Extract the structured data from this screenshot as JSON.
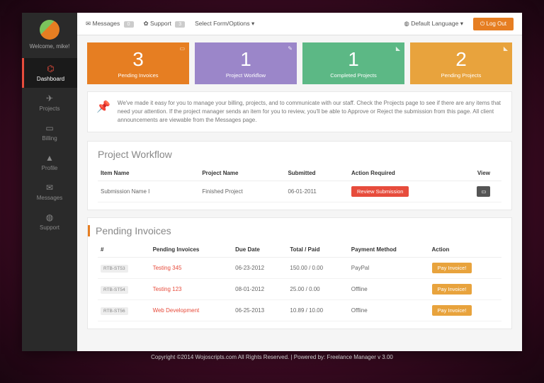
{
  "user": {
    "welcome": "Welcome, mike!"
  },
  "topbar": {
    "messages_label": "Messages",
    "messages_count": "0",
    "support_label": "Support",
    "support_count": "3",
    "form_label": "Select Form/Options",
    "lang_label": "Default Language",
    "logout_label": "Log Out"
  },
  "nav": {
    "dashboard": "Dashboard",
    "projects": "Projects",
    "billing": "Billing",
    "profile": "Profile",
    "messages": "Messages",
    "support": "Support"
  },
  "cards": {
    "c0": {
      "num": "3",
      "label": "Pending Invoices",
      "color": "#e67e22"
    },
    "c1": {
      "num": "1",
      "label": "Project Workflow",
      "color": "#9b86c9"
    },
    "c2": {
      "num": "1",
      "label": "Completed Projects",
      "color": "#5cb885"
    },
    "c3": {
      "num": "2",
      "label": "Pending Projects",
      "color": "#e8a33d"
    }
  },
  "info": "We've made it easy for you to manage your billing, projects, and to communicate with our staff. Check the Projects page to see if there are any items that need your attention. If the project manager sends an item for you to review, you'll be able to Approve or Reject the submission from this page. All client announcements are viewable from the Messages page.",
  "workflow": {
    "title": "Project Workflow",
    "h0": "Item Name",
    "h1": "Project Name",
    "h2": "Submitted",
    "h3": "Action Required",
    "h4": "View",
    "r0": {
      "item": "Submission Name I",
      "project": "Finished Project",
      "date": "06-01-2011",
      "action": "Review Submission"
    }
  },
  "invoices": {
    "title": "Pending Invoices",
    "h0": "#",
    "h1": "Pending Invoices",
    "h2": "Due Date",
    "h3": "Total / Paid",
    "h4": "Payment Method",
    "h5": "Action",
    "r0": {
      "id": "RTB-ST53",
      "name": "Testing 345",
      "due": "06-23-2012",
      "total": "150.00 / 0.00",
      "method": "PayPal",
      "action": "Pay Invoice!"
    },
    "r1": {
      "id": "RTB-ST54",
      "name": "Testing 123",
      "due": "08-01-2012",
      "total": "25.00 / 0.00",
      "method": "Offline",
      "action": "Pay Invoice!"
    },
    "r2": {
      "id": "RTB-ST56",
      "name": "Web Development",
      "due": "06-25-2013",
      "total": "10.89 / 10.00",
      "method": "Offline",
      "action": "Pay Invoice!"
    }
  },
  "footer": "Copyright ©2014 Wojoscripts.com All Rights Reserved. | Powered by: Freelance Manager v 3.00"
}
